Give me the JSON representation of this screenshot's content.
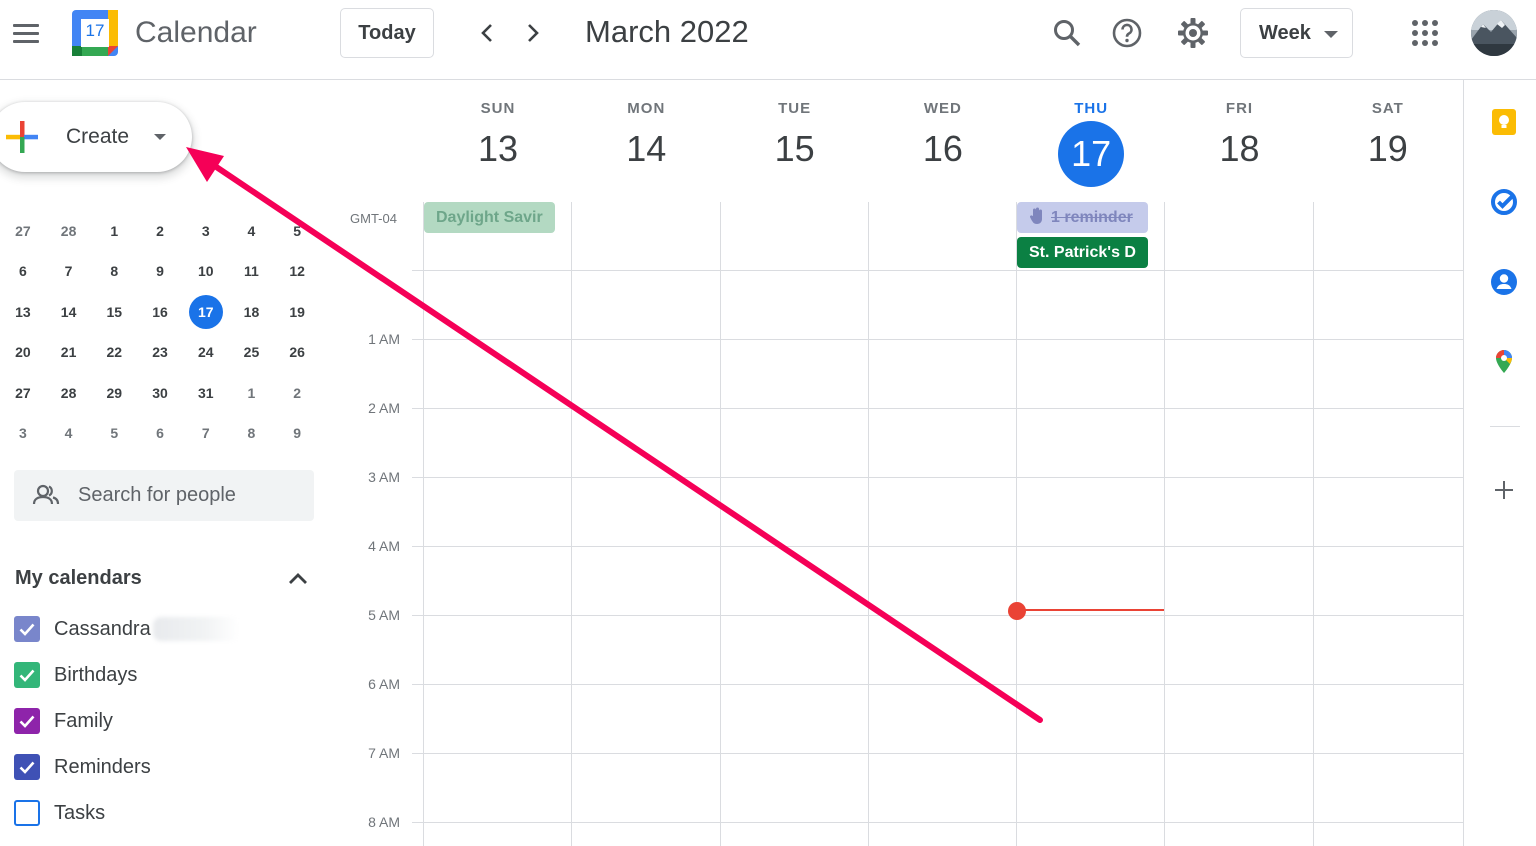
{
  "header": {
    "app_title": "Calendar",
    "logo_day": "17",
    "today_label": "Today",
    "month_title": "March 2022",
    "view_label": "Week",
    "icons": [
      "menu-icon",
      "search-icon",
      "help-icon",
      "gear-icon",
      "apps-grid-icon"
    ]
  },
  "create": {
    "label": "Create"
  },
  "mini_calendar": {
    "weeks": [
      [
        "27",
        "28",
        "1",
        "2",
        "3",
        "4",
        "5"
      ],
      [
        "6",
        "7",
        "8",
        "9",
        "10",
        "11",
        "12"
      ],
      [
        "13",
        "14",
        "15",
        "16",
        "17",
        "18",
        "19"
      ],
      [
        "20",
        "21",
        "22",
        "23",
        "24",
        "25",
        "26"
      ],
      [
        "27",
        "28",
        "29",
        "30",
        "31",
        "1",
        "2"
      ],
      [
        "3",
        "4",
        "5",
        "6",
        "7",
        "8",
        "9"
      ]
    ],
    "today": "17"
  },
  "people_search": {
    "placeholder": "Search for people"
  },
  "my_calendars": {
    "title": "My calendars",
    "items": [
      {
        "label": "Cassandra",
        "color": "#7986cb",
        "checked": true
      },
      {
        "label": "Birthdays",
        "color": "#33b679",
        "checked": true
      },
      {
        "label": "Family",
        "color": "#8e24aa",
        "checked": true
      },
      {
        "label": "Reminders",
        "color": "#3f51b5",
        "checked": true
      },
      {
        "label": "Tasks",
        "color": "#1a73e8",
        "checked": false
      }
    ]
  },
  "week": {
    "timezone": "GMT-04",
    "days": [
      {
        "dow": "SUN",
        "num": "13"
      },
      {
        "dow": "MON",
        "num": "14"
      },
      {
        "dow": "TUE",
        "num": "15"
      },
      {
        "dow": "WED",
        "num": "16"
      },
      {
        "dow": "THU",
        "num": "17",
        "today": true
      },
      {
        "dow": "FRI",
        "num": "18"
      },
      {
        "dow": "SAT",
        "num": "19"
      }
    ],
    "times": [
      "1 AM",
      "2 AM",
      "3 AM",
      "4 AM",
      "5 AM",
      "6 AM",
      "7 AM",
      "8 AM"
    ],
    "events": {
      "daylight": "Daylight Savir",
      "reminder": "1 reminder",
      "st_patricks": "St. Patrick's D"
    }
  },
  "side_panel": {
    "icons": [
      "keep-icon",
      "tasks-icon",
      "contacts-icon",
      "maps-icon",
      "add-icon"
    ]
  },
  "colors": {
    "accent": "#1a73e8",
    "now_line": "#ea4335",
    "annotation_arrow": "#f50057",
    "event_green": "#0b8043"
  }
}
